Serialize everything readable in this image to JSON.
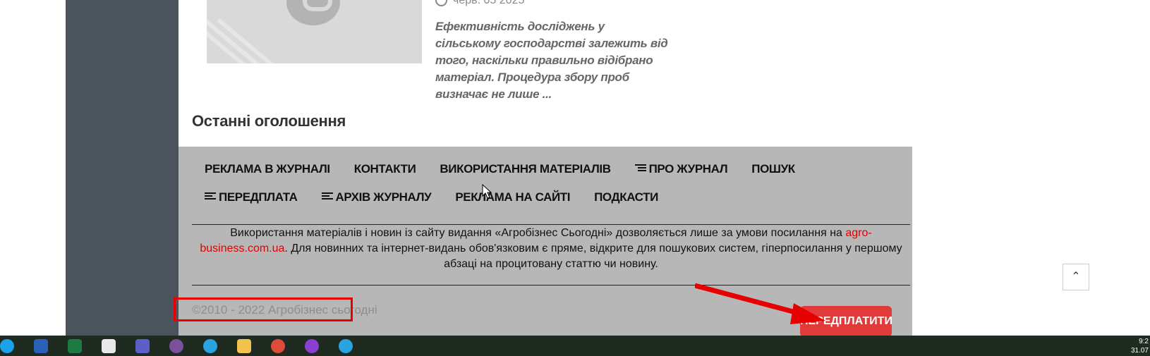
{
  "article": {
    "date": "черв. 05 2025",
    "excerpt": "Ефективність досліджень у сільському господарстві залежить від того, наскільки правильно відібрано матеріал. Процедура збору проб визначає не лише ..."
  },
  "section_title": "Останні оголошення",
  "footer": {
    "nav": [
      {
        "label": "РЕКЛАМА В ЖУРНАЛІ",
        "icon": ""
      },
      {
        "label": "КОНТАКТИ",
        "icon": ""
      },
      {
        "label": "ВИКОРИСТАННЯ МАТЕРІАЛІВ",
        "icon": ""
      },
      {
        "label": "ПРО ЖУРНАЛ",
        "icon": "indent-list-icon"
      },
      {
        "label": "ПОШУК",
        "icon": ""
      },
      {
        "label": "ПЕРЕДПЛАТА",
        "icon": "align-left-icon"
      },
      {
        "label": "АРХІВ ЖУРНАЛУ",
        "icon": "align-left-icon"
      },
      {
        "label": "РЕКЛАМА НА САЙТІ",
        "icon": ""
      },
      {
        "label": "ПОДКАСТИ",
        "icon": ""
      }
    ],
    "notice_before": "Використання матеріалів і новин із сайту видання «Агробізнес Сьогодні» дозволяється лише за умови посилання на ",
    "notice_link": "agro-business.com.ua",
    "notice_after": ". Для новинних та інтернет-видань обов'язковим є пряме, відкрите для пошукових систем, гіперпосилання у першому абзаці на процитовану статтю чи новину.",
    "copyright": "©2010 - 2022 Агробізнес сьогодні",
    "subscribe_label": "ПЕРЕДПЛАТИТИ"
  },
  "scroll_top_icon": "chevron-up-icon",
  "colors": {
    "accent": "#e10000",
    "footer_bg": "#b7b7b7",
    "sidebar": "#4b535c"
  },
  "taskbar": {
    "icons": [
      "edge-icon",
      "word-icon",
      "excel-icon",
      "slack-icon",
      "teams-icon",
      "viber-icon",
      "telegram-icon",
      "file-explorer-icon",
      "chrome-icon",
      "app-icon",
      "telegram-icon"
    ],
    "time": "9:2",
    "date": "31.07"
  }
}
